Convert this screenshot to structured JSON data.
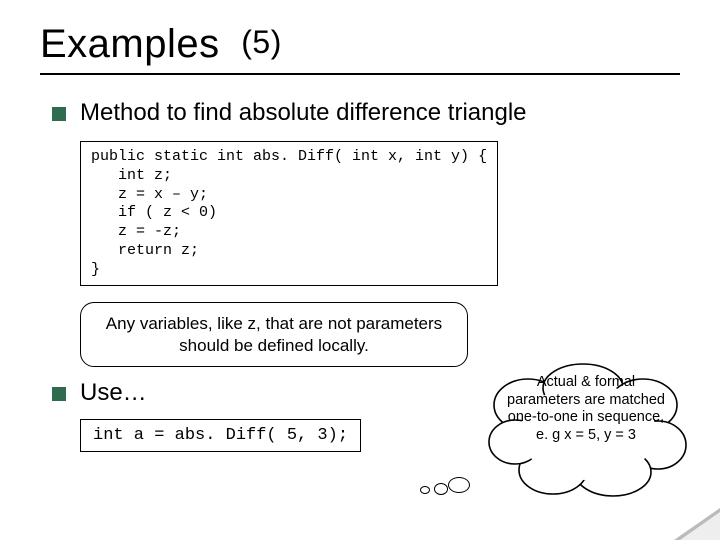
{
  "title": {
    "main": "Examples",
    "num": "(5)"
  },
  "bullet1": "Method to find absolute difference triangle",
  "code1": "public static int abs. Diff( int x, int y) {\n   int z;\n   z = x – y;\n   if ( z < 0)\n   z = -z;\n   return z;\n}",
  "callout": "Any variables, like z, that are not parameters should be defined locally.",
  "bullet2": "Use…",
  "code2": "int a = abs. Diff( 5, 3);",
  "cloud": "Actual & formal parameters are matched one-to-one in sequence, e. g  x = 5,\n      y = 3"
}
